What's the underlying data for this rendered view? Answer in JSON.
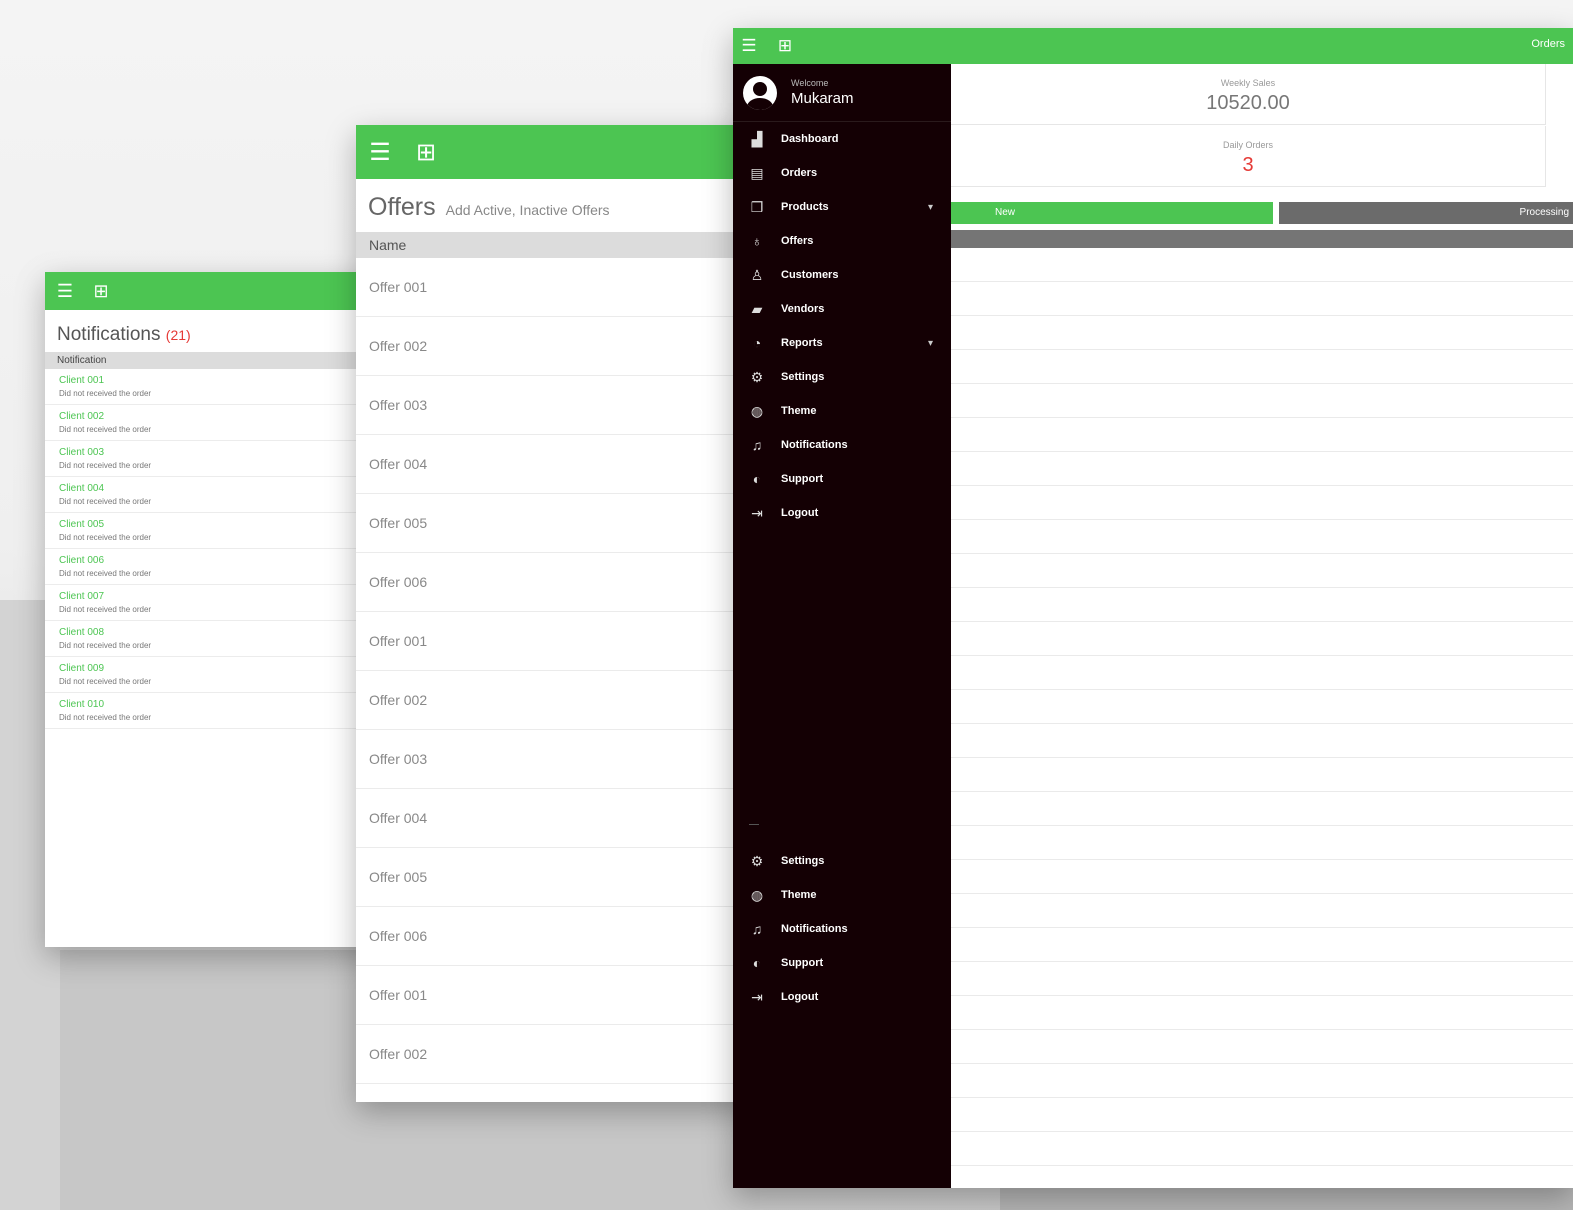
{
  "notifications": {
    "title": "Notifications",
    "count": "(21)",
    "column_header": "Notification",
    "items": [
      {
        "title": "Client 001",
        "subtitle": "Did not received the order"
      },
      {
        "title": "Client 002",
        "subtitle": "Did not received the order"
      },
      {
        "title": "Client 003",
        "subtitle": "Did not received the order"
      },
      {
        "title": "Client 004",
        "subtitle": "Did not received the order"
      },
      {
        "title": "Client 005",
        "subtitle": "Did not received the order"
      },
      {
        "title": "Client 006",
        "subtitle": "Did not received the order"
      },
      {
        "title": "Client 007",
        "subtitle": "Did not received the order"
      },
      {
        "title": "Client 008",
        "subtitle": "Did not received the order"
      },
      {
        "title": "Client 009",
        "subtitle": "Did not received the order"
      },
      {
        "title": "Client 010",
        "subtitle": "Did not received the order"
      }
    ]
  },
  "offers": {
    "title": "Offers",
    "subtitle": "Add Active, Inactive Offers",
    "column_header": "Name",
    "rows": [
      "Offer 001",
      "Offer 002",
      "Offer 003",
      "Offer 004",
      "Offer 005",
      "Offer 006",
      "Offer 001",
      "Offer 002",
      "Offer 003",
      "Offer 004",
      "Offer 005",
      "Offer 006",
      "Offer 001",
      "Offer 002"
    ]
  },
  "dashboard": {
    "topbar_right": "Orders",
    "user": {
      "welcome": "Welcome",
      "name": "Mukaram"
    },
    "menu": [
      {
        "label": "Dashboard",
        "icon": "chart-icon",
        "glyph": "▟",
        "has_arrow": false
      },
      {
        "label": "Orders",
        "icon": "calendar-icon",
        "glyph": "▤",
        "has_arrow": false
      },
      {
        "label": "Products",
        "icon": "box-icon",
        "glyph": "❒",
        "has_arrow": true
      },
      {
        "label": "Offers",
        "icon": "tag-icon",
        "glyph": "♁",
        "has_arrow": false
      },
      {
        "label": "Customers",
        "icon": "user-icon",
        "glyph": "♙",
        "has_arrow": false
      },
      {
        "label": "Vendors",
        "icon": "truck-icon",
        "glyph": "▰",
        "has_arrow": false
      },
      {
        "label": "Reports",
        "icon": "pie-icon",
        "glyph": "◔",
        "has_arrow": true
      },
      {
        "label": "Settings",
        "icon": "gear-icon",
        "glyph": "⚙",
        "has_arrow": false
      },
      {
        "label": "Theme",
        "icon": "globe-icon",
        "glyph": "◍",
        "has_arrow": false
      },
      {
        "label": "Notifications",
        "icon": "bell-icon",
        "glyph": "♫",
        "has_arrow": false
      },
      {
        "label": "Support",
        "icon": "headset-icon",
        "glyph": "◐",
        "has_arrow": false
      },
      {
        "label": "Logout",
        "icon": "logout-icon",
        "glyph": "⇥",
        "has_arrow": false
      }
    ],
    "menu_bottom": [
      {
        "label": "Settings",
        "icon": "gear-icon",
        "glyph": "⚙"
      },
      {
        "label": "Theme",
        "icon": "globe-icon",
        "glyph": "◍"
      },
      {
        "label": "Notifications",
        "icon": "bell-icon",
        "glyph": "♫"
      },
      {
        "label": "Support",
        "icon": "headset-icon",
        "glyph": "◐"
      },
      {
        "label": "Logout",
        "icon": "logout-icon",
        "glyph": "⇥"
      }
    ],
    "stats": {
      "weekly_label": "Weekly Sales",
      "weekly_value": "10520.00",
      "orders_label": "Daily Orders",
      "orders_value": "3"
    },
    "tabs": {
      "new": "New",
      "processing": "Processing"
    }
  },
  "colors": {
    "accent": "#4cc552",
    "sidebar": "#140004",
    "alert": "#e53935"
  }
}
